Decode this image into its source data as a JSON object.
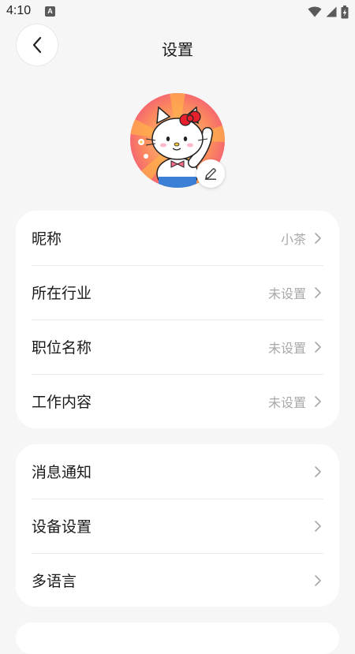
{
  "status_bar": {
    "time": "4:10",
    "notification_badge": "A"
  },
  "header": {
    "title": "设置"
  },
  "profile_card": {
    "rows": [
      {
        "label": "昵称",
        "value": "小茶"
      },
      {
        "label": "所在行业",
        "value": "未设置"
      },
      {
        "label": "职位名称",
        "value": "未设置"
      },
      {
        "label": "工作内容",
        "value": "未设置"
      }
    ]
  },
  "preferences_card": {
    "rows": [
      {
        "label": "消息通知"
      },
      {
        "label": "设备设置"
      },
      {
        "label": "多语言"
      }
    ]
  },
  "colors": {
    "background": "#f6f6f6",
    "card": "#ffffff",
    "value_text": "#a8a8a8",
    "chevron": "#a6a6a6"
  },
  "icons": {
    "back": "chevron-left-icon",
    "edit": "pencil-icon",
    "row_arrow": "chevron-right-icon",
    "wifi": "wifi-icon",
    "signal": "signal-icon",
    "battery": "battery-charging-icon"
  }
}
